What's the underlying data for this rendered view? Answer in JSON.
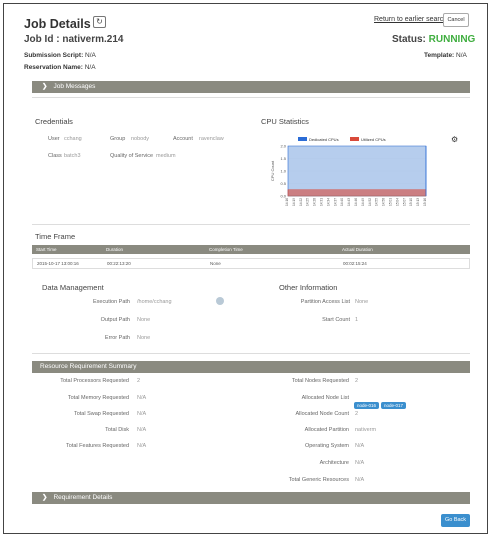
{
  "page": {
    "title": "Job Details",
    "refresh_icon": "refresh-icon",
    "back_link": "Return to earlier search",
    "cancel_label": "Cancel",
    "job_id_label": "Job Id : ",
    "job_id": "nativerm.214",
    "status_label": "Status: ",
    "status_value": "RUNNING",
    "status_color": "#3fae3f",
    "submission_script_label": "Submission Script: ",
    "submission_script": "N/A",
    "template_label": "Template: ",
    "template": "N/A",
    "reservation_label": "Reservation Name: ",
    "reservation": "N/A"
  },
  "sections": {
    "job_messages": "Job Messages",
    "credentials_title": "Credentials",
    "cpu_title": "CPU Statistics",
    "time_frame": "Time Frame",
    "data_management": "Data Management",
    "other_information": "Other Information",
    "resource_summary": "Resource Requirement Summary",
    "requirement_details": "Requirement Details",
    "go_back": "Go Back"
  },
  "credentials": {
    "user_label": "User",
    "user": "cchang",
    "group_label": "Group",
    "group": "nobody",
    "account_label": "Account",
    "account": "ravenclaw",
    "class_label": "Class",
    "class": "batch3",
    "qos_label": "Quality of Service",
    "qos": "medium"
  },
  "time_frame": {
    "headers": [
      "Start Time",
      "Duration",
      "Completion Time",
      "Actual Duration"
    ],
    "row": [
      "2015-10-17 13:00:16",
      "00:22:13:20",
      "None",
      "00:02:15:24"
    ]
  },
  "data_mgmt": {
    "exec_path_label": "Execution Path",
    "exec_path": "/home/cchang",
    "output_path_label": "Output Path",
    "output_path": "None",
    "error_path_label": "Error Path",
    "error_path": "None"
  },
  "other_info": {
    "partition_access_label": "Partition Access List",
    "partition_access": "None",
    "start_count_label": "Start Count",
    "start_count": "1"
  },
  "resource_left": [
    {
      "label": "Total Processors Requested",
      "value": "2"
    },
    {
      "label": "Total Memory Requested",
      "value": "N/A"
    },
    {
      "label": "Total Swap Requested",
      "value": "N/A"
    },
    {
      "label": "Total Disk",
      "value": "N/A"
    },
    {
      "label": "Total Features Requested",
      "value": "N/A"
    }
  ],
  "resource_right": {
    "nodes_req_label": "Total Nodes Requested",
    "nodes_req": "2",
    "alloc_list_label": "Allocated Node List",
    "alloc_nodes": [
      "node-016",
      "node-017"
    ],
    "alloc_count_label": "Allocated Node Count",
    "alloc_count": "2",
    "alloc_partition_label": "Allocated Partition",
    "alloc_partition": "nativerm",
    "os_label": "Operating System",
    "os": "N/A",
    "arch_label": "Architecture",
    "arch": "N/A",
    "generic_label": "Total Generic Resources",
    "generic": "N/A"
  },
  "chart_data": {
    "type": "area",
    "ylabel": "CPU Count",
    "ylim": [
      0,
      2.0
    ],
    "yticks": [
      "2.0",
      "1.5",
      "1.0",
      "0.5",
      "0.0"
    ],
    "x": [
      "14:16",
      "14:19",
      "14:22",
      "14:25",
      "14:28",
      "14:31",
      "14:34",
      "14:37",
      "14:40",
      "14:43",
      "14:46",
      "14:49",
      "14:52",
      "14:55",
      "14:58",
      "15:01",
      "15:04",
      "15:07",
      "15:10",
      "15:13",
      "15:16"
    ],
    "series": [
      {
        "name": "Dedicated CPUs",
        "color": "#a9c4ea",
        "values": [
          2,
          2,
          2,
          2,
          2,
          2,
          2,
          2,
          2,
          2,
          2,
          2,
          2,
          2,
          2,
          2,
          2,
          2,
          2,
          2,
          2
        ]
      },
      {
        "name": "Utilized CPUs",
        "color": "#d94a3a",
        "values": [
          0.25,
          0.25,
          0.25,
          0.25,
          0.25,
          0.25,
          0.25,
          0.25,
          0.25,
          0.25,
          0.25,
          0.25,
          0.25,
          0.25,
          0.25,
          0.25,
          0.25,
          0.25,
          0.25,
          0.25,
          0.25
        ]
      }
    ]
  }
}
